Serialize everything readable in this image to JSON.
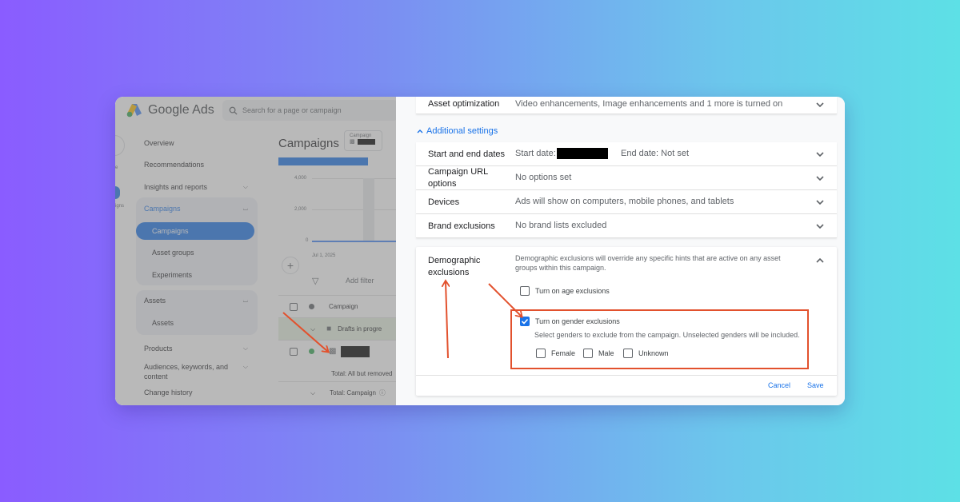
{
  "colors": {
    "accent": "#1a73e8",
    "annotation": "#e2512d",
    "bg_left": "#8a5cff",
    "bg_right": "#5de0e6"
  },
  "app": {
    "brand": "Google Ads",
    "search_placeholder": "Search for a page or campaign",
    "rail": {
      "label1": "e",
      "label2": "igns"
    },
    "nav": {
      "overview": "Overview",
      "recommendations": "Recommendations",
      "insights": "Insights and reports",
      "campaigns_group": "Campaigns",
      "campaigns": "Campaigns",
      "asset_groups": "Asset groups",
      "experiments": "Experiments",
      "assets_group": "Assets",
      "assets": "Assets",
      "products": "Products",
      "audiences": "Audiences, keywords, and content",
      "change_history": "Change history"
    },
    "page_title": "Campaigns",
    "chip_label": "Campaign",
    "chart": {
      "y_ticks": [
        "4,000",
        "2,000",
        "0"
      ],
      "x_tick": "Jul 1, 2025"
    },
    "add_filter": "Add filter",
    "table": {
      "header": "Campaign",
      "drafts": "Drafts in progre",
      "total_removed": "Total: All but removed",
      "total_campaign": "Total: Campaign"
    }
  },
  "panel": {
    "asset_optimization": {
      "title": "Asset optimization",
      "value": "Video enhancements, Image enhancements and 1 more is turned on"
    },
    "additional_settings": "Additional settings",
    "rows": [
      {
        "title": "Start and end dates",
        "value": "Start date:",
        "extra": "End date: Not set"
      },
      {
        "title": "Campaign URL options",
        "value": "No options set"
      },
      {
        "title": "Devices",
        "value": "Ads will show on computers, mobile phones, and tablets"
      },
      {
        "title": "Brand exclusions",
        "value": "No brand lists excluded"
      }
    ],
    "demographic": {
      "title": "Demographic exclusions",
      "description": "Demographic exclusions will override any specific hints that are active on any asset groups within this campaign.",
      "age_label": "Turn on age exclusions",
      "gender_label": "Turn on gender exclusions",
      "gender_hint": "Select genders to exclude from the campaign. Unselected genders will be included.",
      "genders": [
        "Female",
        "Male",
        "Unknown"
      ],
      "cancel": "Cancel",
      "save": "Save"
    }
  }
}
